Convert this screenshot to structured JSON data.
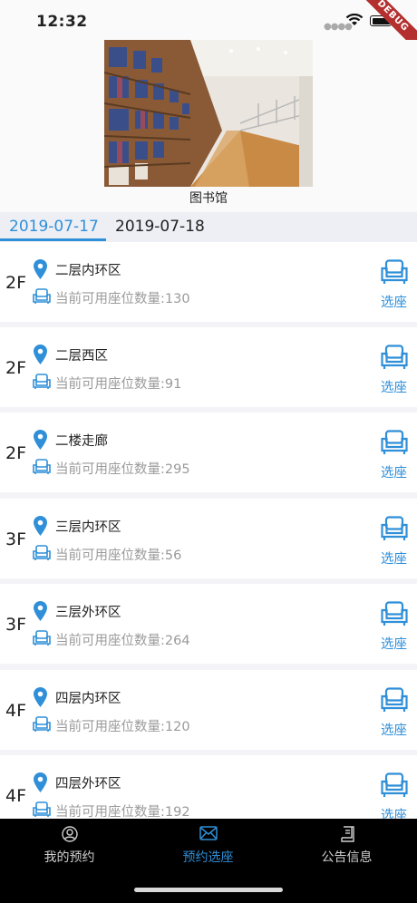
{
  "status_bar": {
    "time": "12:32",
    "debug_label": "DEBUG"
  },
  "library": {
    "name": "图书馆"
  },
  "date_tabs": [
    {
      "label": "2019-07-17",
      "active": true
    },
    {
      "label": "2019-07-18",
      "active": false
    }
  ],
  "rooms": [
    {
      "floor": "2F",
      "name": "二层内环区",
      "seats": "当前可用座位数量:130",
      "action": "选座"
    },
    {
      "floor": "2F",
      "name": "二层西区",
      "seats": "当前可用座位数量:91",
      "action": "选座"
    },
    {
      "floor": "2F",
      "name": "二楼走廊",
      "seats": "当前可用座位数量:295",
      "action": "选座"
    },
    {
      "floor": "3F",
      "name": "三层内环区",
      "seats": "当前可用座位数量:56",
      "action": "选座"
    },
    {
      "floor": "3F",
      "name": "三层外环区",
      "seats": "当前可用座位数量:264",
      "action": "选座"
    },
    {
      "floor": "4F",
      "name": "四层内环区",
      "seats": "当前可用座位数量:120",
      "action": "选座"
    },
    {
      "floor": "4F",
      "name": "四层外环区",
      "seats": "当前可用座位数量:192",
      "action": "选座"
    }
  ],
  "bottom_nav": [
    {
      "label": "我的预约",
      "icon": "person-icon",
      "active": false
    },
    {
      "label": "预约选座",
      "icon": "envelope-icon",
      "active": true
    },
    {
      "label": "公告信息",
      "icon": "notice-icon",
      "active": false
    }
  ],
  "colors": {
    "accent": "#2f8fd8",
    "nav_background": "#000000",
    "muted_text": "#9a9a9a"
  }
}
